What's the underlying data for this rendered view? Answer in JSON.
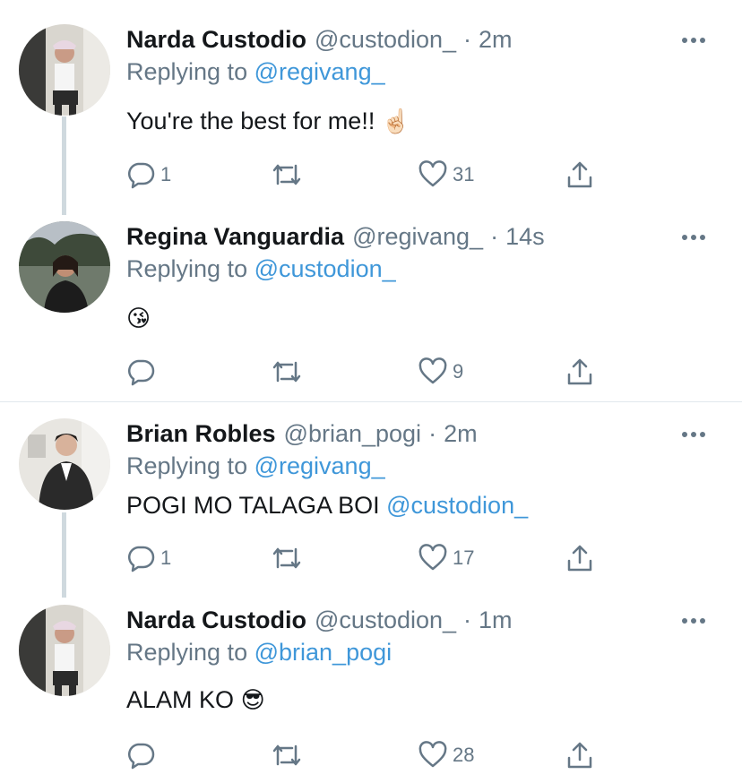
{
  "tweets": [
    {
      "name": "Narda Custodio",
      "handle": "@custodion_",
      "time": "2m",
      "replying_label": "Replying to",
      "replying_to": "@regivang_",
      "text": "You're the best for me!!",
      "emoji": "☝🏻",
      "replies": "1",
      "likes": "31"
    },
    {
      "name": "Regina Vanguardia",
      "handle": "@regivang_",
      "time": "14s",
      "replying_label": "Replying to",
      "replying_to": "@custodion_",
      "text": "",
      "emoji": "😘",
      "replies": "",
      "likes": "9"
    },
    {
      "name": "Brian Robles",
      "handle": "@brian_pogi",
      "time": "2m",
      "replying_label": "Replying to",
      "replying_to": "@regivang_",
      "text": "POGI MO TALAGA BOI",
      "text_mention": "@custodion_",
      "replies": "1",
      "likes": "17"
    },
    {
      "name": "Narda Custodio",
      "handle": "@custodion_",
      "time": "1m",
      "replying_label": "Replying to",
      "replying_to": "@brian_pogi",
      "text": "ALAM KO",
      "emoji": "😎",
      "replies": "",
      "likes": "28"
    }
  ],
  "colors": {
    "link": "#3f97d9",
    "secondary": "#657786",
    "thread_line": "#cfd9de",
    "divider": "#e1e8ed"
  },
  "icons": [
    "reply-icon",
    "retweet-icon",
    "like-icon",
    "share-icon",
    "more-icon"
  ]
}
